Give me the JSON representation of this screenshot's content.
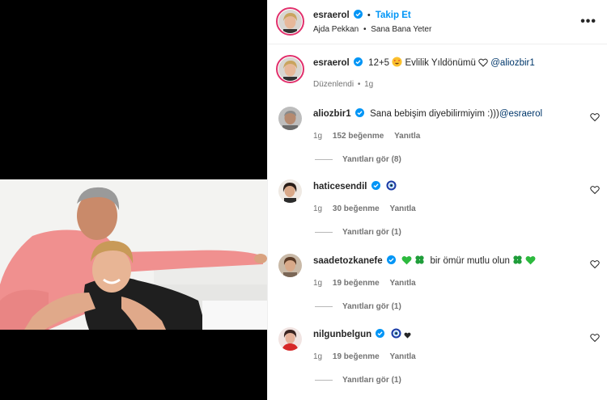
{
  "header": {
    "username": "esraerol",
    "follow_label": "Takip Et",
    "dot": "•",
    "audio_artist": "Ajda Pekkan",
    "audio_song": "Sana Bana Yeter",
    "more_label": "•••"
  },
  "caption": {
    "username": "esraerol",
    "text": "12+5",
    "text2": "Evlilik Yıldönümü",
    "mention": "@aliozbir1",
    "edited": "Düzenlendi",
    "time": "1g"
  },
  "comments": [
    {
      "username": "aliozbir1",
      "text": "Sana bebişim diyebilirmiyim :)))",
      "mention": "@esraerol",
      "time": "1g",
      "likes": "152 beğenme",
      "reply_label": "Yanıtla",
      "view_replies": "Yanıtları gör (8)"
    },
    {
      "username": "haticesendil",
      "text": "",
      "time": "1g",
      "likes": "30 beğenme",
      "reply_label": "Yanıtla",
      "view_replies": "Yanıtları gör (1)"
    },
    {
      "username": "saadetozkanefe",
      "text": "bir ömür mutlu olun",
      "time": "1g",
      "likes": "19 beğenme",
      "reply_label": "Yanıtla",
      "view_replies": "Yanıtları gör (1)"
    },
    {
      "username": "nilgunbelgun",
      "text": "",
      "time": "1g",
      "likes": "19 beğenme",
      "reply_label": "Yanıtla",
      "view_replies": "Yanıtları gör (1)"
    }
  ],
  "colors": {
    "accent": "#0095f6",
    "verified": "#0095f6",
    "mention": "#00376b",
    "muted": "#737373"
  }
}
